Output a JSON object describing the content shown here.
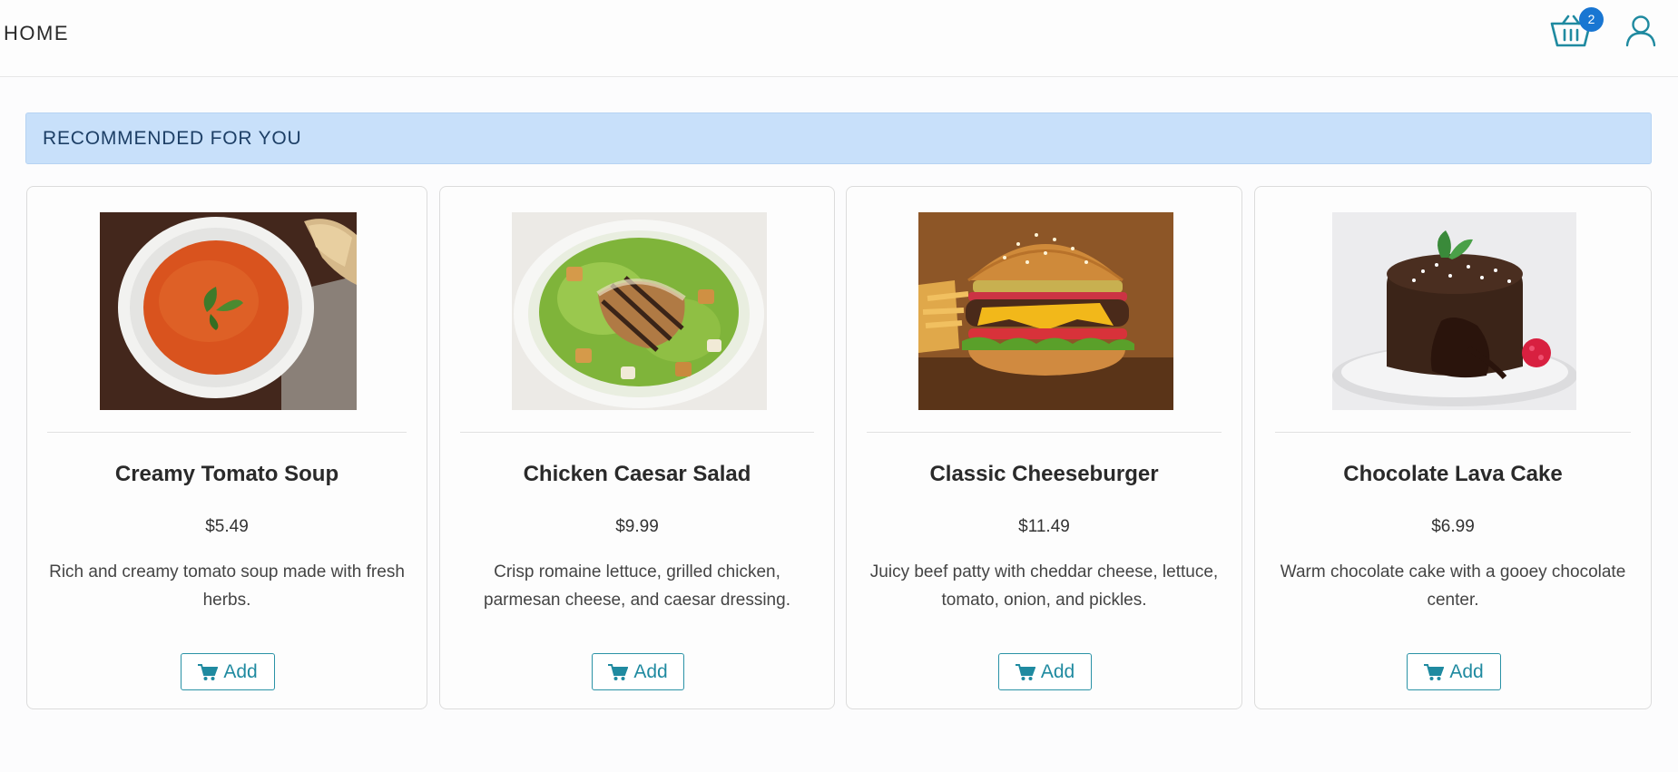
{
  "nav": {
    "home_label": "HOME",
    "cart_icon": "shopping-basket-icon",
    "cart_count": "2",
    "user_icon": "user-icon"
  },
  "banner": {
    "title": "RECOMMENDED FOR YOU"
  },
  "colors": {
    "accent": "#1f8aa0",
    "badge": "#1976d2",
    "banner_bg": "#c8e0fa"
  },
  "products": [
    {
      "name": "Creamy Tomato Soup",
      "price": "$5.49",
      "description": "Rich and creamy tomato soup made with fresh herbs.",
      "add_label": "Add",
      "add_icon": "cart-icon"
    },
    {
      "name": "Chicken Caesar Salad",
      "price": "$9.99",
      "description": "Crisp romaine lettuce, grilled chicken, parmesan cheese, and caesar dressing.",
      "add_label": "Add",
      "add_icon": "cart-icon"
    },
    {
      "name": "Classic Cheeseburger",
      "price": "$11.49",
      "description": "Juicy beef patty with cheddar cheese, lettuce, tomato, onion, and pickles.",
      "add_label": "Add",
      "add_icon": "cart-icon"
    },
    {
      "name": "Chocolate Lava Cake",
      "price": "$6.99",
      "description": "Warm chocolate cake with a gooey chocolate center.",
      "add_label": "Add",
      "add_icon": "cart-icon"
    }
  ]
}
